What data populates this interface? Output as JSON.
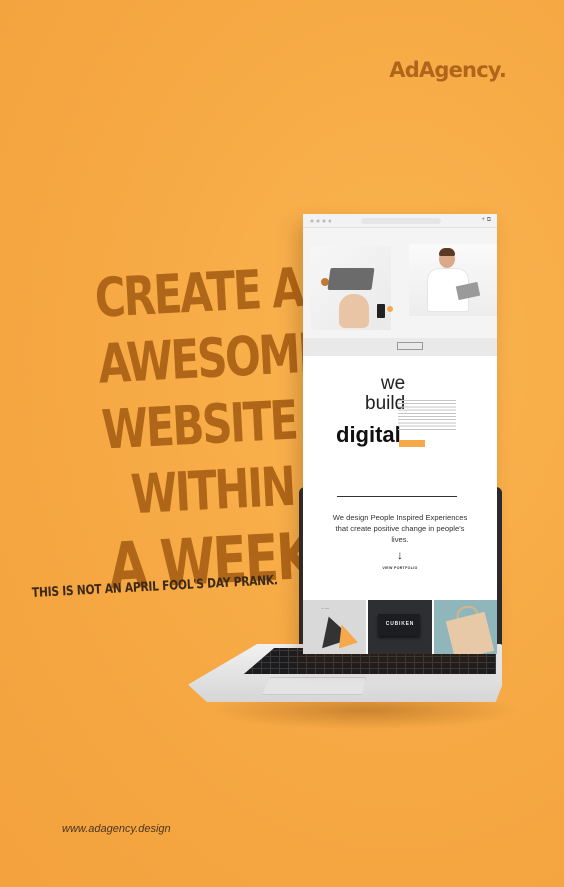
{
  "brand": {
    "name": "AdAgency."
  },
  "headline": {
    "lines": [
      "CREATE AN",
      "AWESOME",
      "WEBSITE",
      "WITHIN",
      "A WEEK!"
    ]
  },
  "tagline": "THIS IS NOT AN APRIL FOOL'S DAY PRANK.",
  "url": "www.adagency.design",
  "site": {
    "intro": {
      "we": "we",
      "build": "build",
      "digital": "digital"
    },
    "mission": {
      "text": "We design People Inspired Experiences that create positive change in people's lives.",
      "arrow": "↓",
      "link": "VIEW PORTFOLIO"
    },
    "portfolio": {
      "cubiken_name": "CUBIKEN"
    }
  },
  "colors": {
    "background": "#F7AC45",
    "headline": "#B06618",
    "accent": "#F5A94A"
  }
}
